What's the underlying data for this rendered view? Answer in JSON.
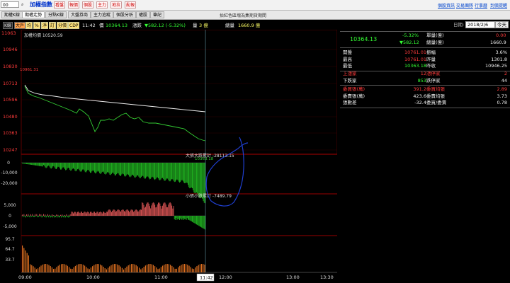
{
  "topbar": {
    "select_value": "00",
    "title": "加權指數",
    "menu": [
      "看盤",
      "報價",
      "個股",
      "主力",
      "地拉",
      "亂報"
    ],
    "links": [
      "個股資訊",
      "交易團隊",
      "行事曆",
      "到價提醒"
    ]
  },
  "tabs": [
    "期權K線",
    "期權走勢",
    "分點K線",
    "大盤券商",
    "主力追蹤",
    "個股分析",
    "權股",
    "筆記"
  ],
  "tab_active_index": 1,
  "notice": "抬紅色區塊為集期貨期間",
  "toolbar": {
    "buttons": [
      "K線",
      "大戶",
      "均",
      "%",
      "淨",
      "訂",
      "分價",
      "CDP"
    ],
    "time": "11:42",
    "price_label": "價",
    "price": "10364.13",
    "change_label": "漲跌",
    "change": "▼582.12 (-5.32%)",
    "vol_label": "量",
    "vol": "3 億",
    "total_label": "總量",
    "total": "1660.9 億"
  },
  "price_panel": {
    "avg_label": "加權均價 10520.59",
    "prev_close_label": "10961.31",
    "last_label": "10363.18",
    "y_ticks": [
      "11063",
      "10946",
      "10830",
      "10713",
      "10596",
      "10480",
      "10363",
      "10247"
    ]
  },
  "big_panel": {
    "label": "大張大跌累計 -28113.15",
    "y_ticks": [
      "0",
      "-10,000",
      "-20,000"
    ]
  },
  "small_panel": {
    "label": "小張小跌累計 -7489.79",
    "y_ticks": [
      "5,000",
      "0",
      "-5,000"
    ]
  },
  "vol_panel": {
    "y_ticks": [
      "95.7",
      "64.7",
      "33.7"
    ]
  },
  "x_axis": {
    "ticks": [
      "09:00",
      "10:00",
      "11:00",
      "11:42",
      "12:00",
      "13:00",
      "13:30"
    ],
    "cursor": "11:42"
  },
  "right_panel": {
    "date_label": "日期:",
    "date": "2018/2/6",
    "today_btn": "今天",
    "price": "10364.13",
    "pct": "-5.32%",
    "change": "▼582.12",
    "single_label": "單量(億)",
    "single_val": "0.00",
    "total_label": "總量(億)",
    "total_val": "1660.9",
    "rows": [
      {
        "l": "開盤",
        "v": "10761.01",
        "l2": "振幅",
        "v2": "3.6%"
      },
      {
        "l": "最高",
        "v": "10761.01",
        "l2": "昨量",
        "v2": "1301.8"
      },
      {
        "l": "最低",
        "v": "10363.18",
        "l2": "昨收",
        "v2": "10946.25"
      }
    ],
    "rows2": [
      {
        "l": "上漲家",
        "v": "12",
        "l2": "漲停家",
        "v2": "2"
      },
      {
        "l": "下跌家",
        "v": "853",
        "l2": "跌停家",
        "v2": "44"
      }
    ],
    "rows3": [
      {
        "l": "委買張(萬)",
        "v": "391.2",
        "l2": "委買均張",
        "v2": "2.89"
      },
      {
        "l": "委賣張(萬)",
        "v": "423.6",
        "l2": "委賣均張",
        "v2": "3.73"
      },
      {
        "l": "張數差",
        "v": "-32.4",
        "l2": "委買/委賣",
        "v2": "0.78"
      }
    ]
  }
}
